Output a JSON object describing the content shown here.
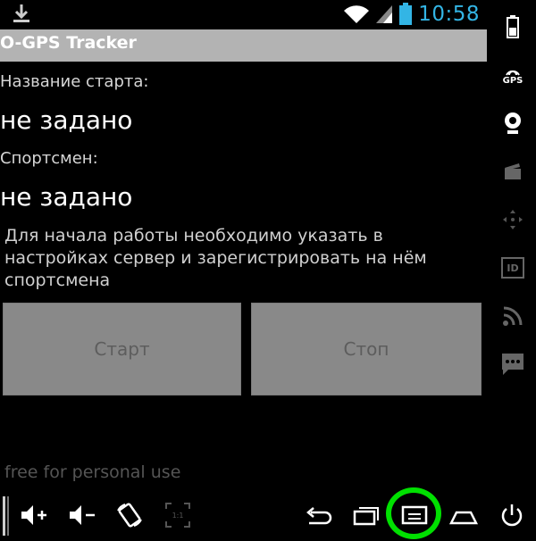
{
  "status": {
    "time": "10:58"
  },
  "app": {
    "title": "O-GPS Tracker"
  },
  "fields": {
    "start_label": "Название старта:",
    "start_value": "не задано",
    "athlete_label": "Спортсмен:",
    "athlete_value": "не задано"
  },
  "hint": "Для начала работы необходимо указать в настройках сервер и зарегистрировать на нём спортсмена",
  "buttons": {
    "start": "Старт",
    "stop": "Стоп"
  },
  "watermark": "free for personal use",
  "sidebar": {
    "gps_label": "GPS",
    "id_label": "ID"
  },
  "navbar": {
    "rotate_label": "1:1"
  },
  "colors": {
    "clock": "#33b5e5",
    "highlight": "#00e000",
    "titlebar": "#b3b3b3",
    "button": "#898989"
  }
}
